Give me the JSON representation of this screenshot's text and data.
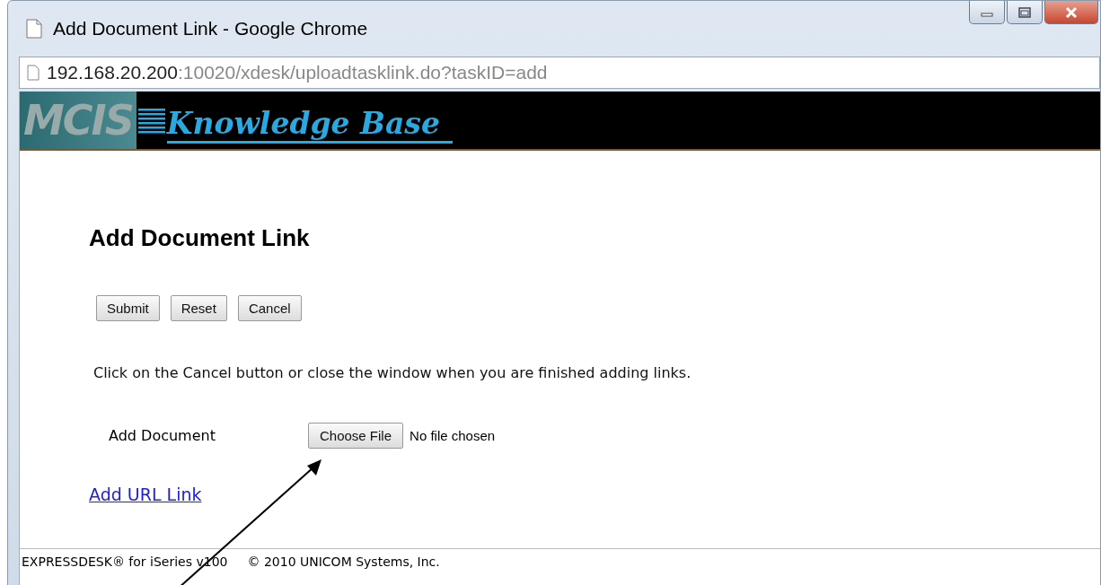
{
  "window": {
    "title": "Add Document Link - Google Chrome"
  },
  "address_bar": {
    "host": "192.168.20.200",
    "path": ":10020/xdesk/uploadtasklink.do?taskID=add"
  },
  "banner": {
    "logo": "MCIS",
    "title": "Knowledge Base"
  },
  "page": {
    "heading": "Add Document Link",
    "buttons": [
      "Submit",
      "Reset",
      "Cancel"
    ],
    "instructions": "Click on the Cancel button or close the window when you are finished adding links.",
    "file_field": {
      "label": "Add Document",
      "button": "Choose File",
      "status": "No file chosen"
    },
    "link": "Add URL Link"
  },
  "footer": {
    "product": "EXPRESSDESK® for iSeries v100",
    "copyright": "© 2010 UNICOM Systems, Inc."
  }
}
